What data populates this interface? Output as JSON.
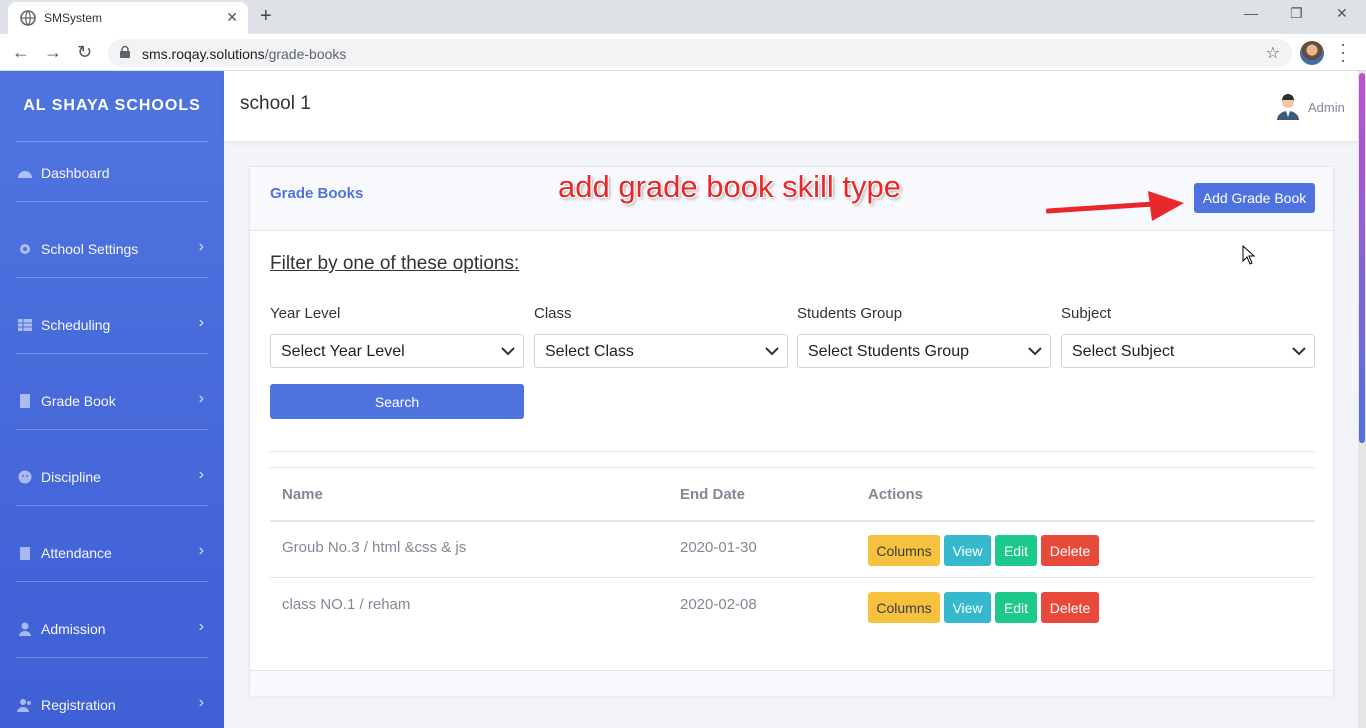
{
  "browser": {
    "tab_title": "SMSystem",
    "url_host": "sms.roqay.solutions",
    "url_path": "/grade-books"
  },
  "sidebar": {
    "brand": "AL SHAYA SCHOOLS",
    "items": [
      {
        "label": "Dashboard",
        "icon": "dashboard-icon",
        "has_submenu": false
      },
      {
        "label": "School Settings",
        "icon": "gear-icon",
        "has_submenu": true
      },
      {
        "label": "Scheduling",
        "icon": "table-icon",
        "has_submenu": true
      },
      {
        "label": "Grade Book",
        "icon": "book-icon",
        "has_submenu": true
      },
      {
        "label": "Discipline",
        "icon": "face-icon",
        "has_submenu": true
      },
      {
        "label": "Attendance",
        "icon": "clipboard-icon",
        "has_submenu": true
      },
      {
        "label": "Admission",
        "icon": "user-icon",
        "has_submenu": true
      },
      {
        "label": "Registration",
        "icon": "users-icon",
        "has_submenu": true
      }
    ]
  },
  "topbar": {
    "title": "school 1",
    "user_name": "Admin"
  },
  "card": {
    "title": "Grade Books",
    "add_button": "Add Grade Book",
    "annotation": "add grade book skill type"
  },
  "filters": {
    "heading": "Filter by one of these options:",
    "fields": [
      {
        "label": "Year Level",
        "value": "Select Year Level"
      },
      {
        "label": "Class",
        "value": "Select Class"
      },
      {
        "label": "Students Group",
        "value": "Select Students Group"
      },
      {
        "label": "Subject",
        "value": "Select Subject"
      }
    ],
    "search_button": "Search"
  },
  "table": {
    "columns": [
      "Name",
      "End Date",
      "Actions"
    ],
    "rows": [
      {
        "name": "Groub No.3 / html &css & js",
        "end_date": "2020-01-30"
      },
      {
        "name": "class NO.1 / reham",
        "end_date": "2020-02-08"
      }
    ],
    "actions": {
      "columns": "Columns",
      "view": "View",
      "edit": "Edit",
      "delete": "Delete"
    }
  },
  "colors": {
    "primary": "#4e73df",
    "warning": "#f6c23e",
    "info": "#36b9cc",
    "success": "#1cc88a",
    "danger": "#e74a3b",
    "annotation": "#e8282b"
  }
}
